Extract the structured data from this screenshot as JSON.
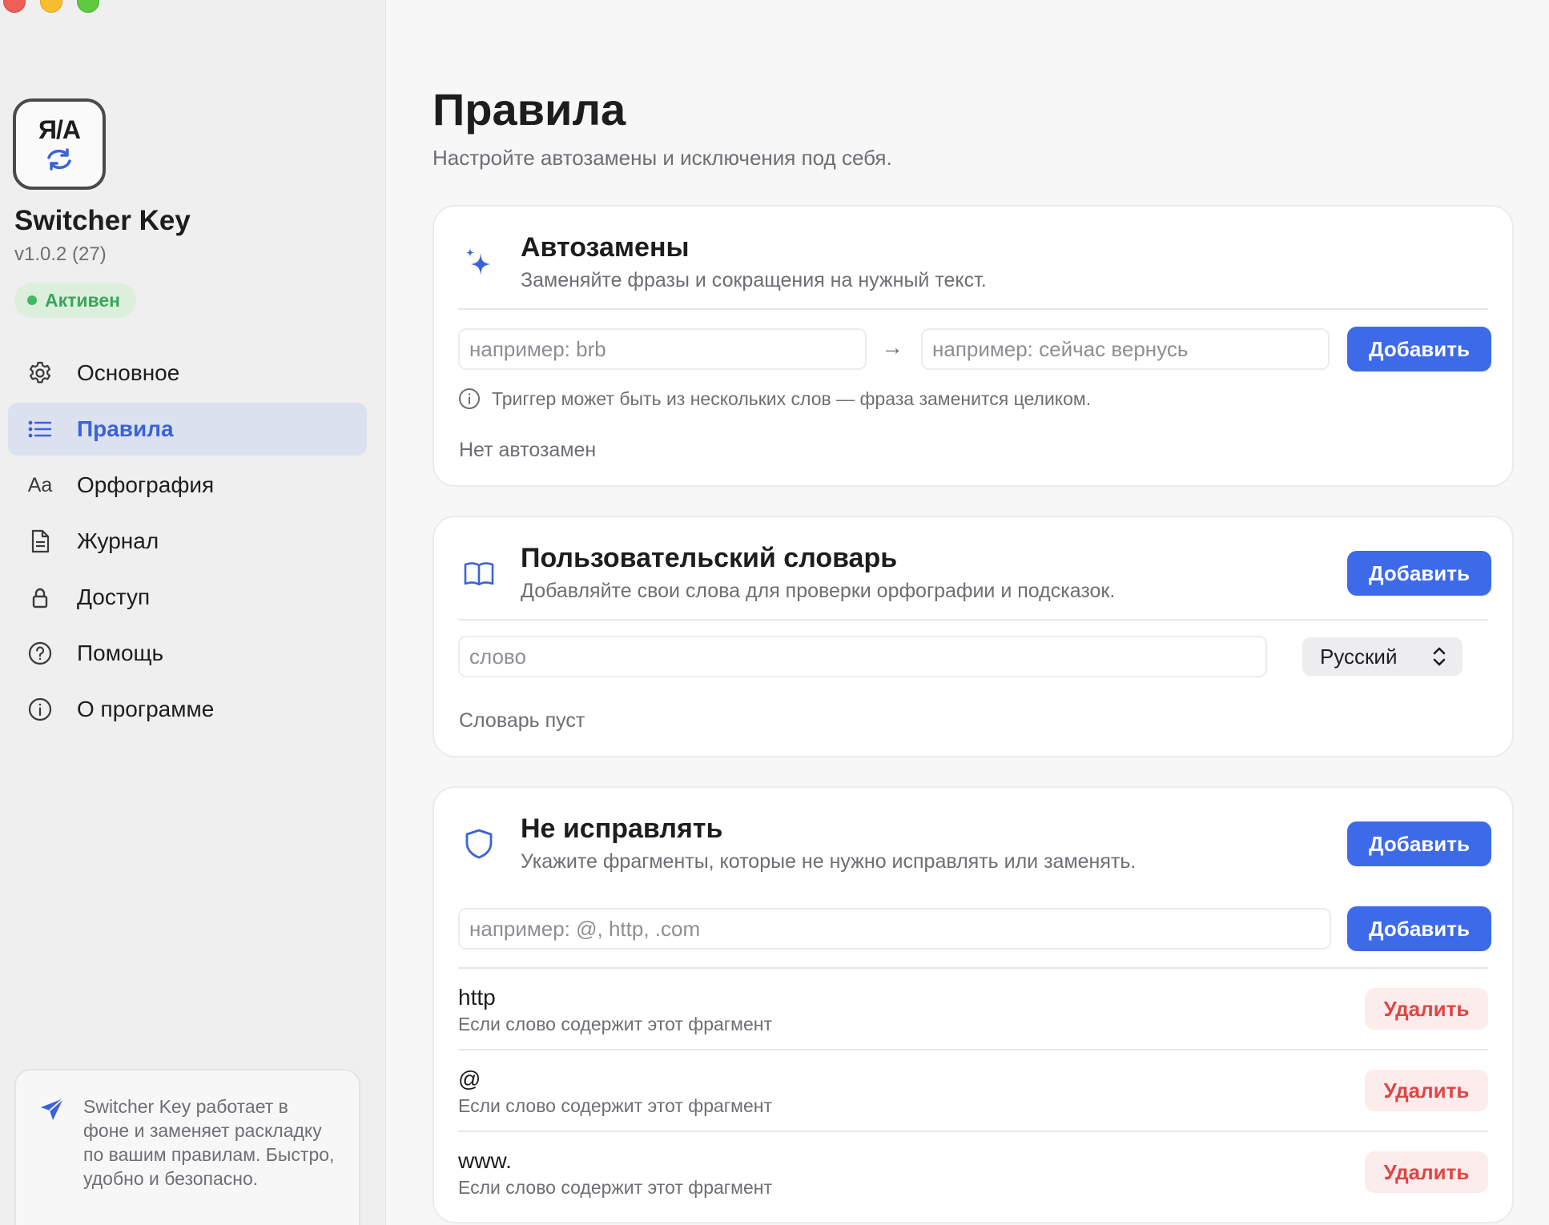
{
  "app": {
    "icon_text": "Я/А",
    "name": "Switcher Key",
    "version": "v1.0.2 (27)",
    "status": "Активен",
    "status_color": "#3fbb5f"
  },
  "sidebar": {
    "items": [
      {
        "label": "Основное",
        "icon": "gear-icon",
        "active": false
      },
      {
        "label": "Правила",
        "icon": "list-icon",
        "active": true
      },
      {
        "label": "Орфография",
        "icon": "text-aa-icon",
        "icon_text": "Aa",
        "active": false
      },
      {
        "label": "Журнал",
        "icon": "document-icon",
        "active": false
      },
      {
        "label": "Доступ",
        "icon": "lock-icon",
        "active": false
      },
      {
        "label": "Помощь",
        "icon": "question-circle-icon",
        "active": false
      },
      {
        "label": "О программе",
        "icon": "info-circle-icon",
        "active": false
      }
    ],
    "info_text": "Switcher Key работает в фоне и заменяет раскладку по вашим правилам. Быстро, удобно и безопасно."
  },
  "page": {
    "title": "Правила",
    "subtitle": "Настройте автозамены и исключения под себя."
  },
  "autoreplace": {
    "title": "Автозамены",
    "description": "Заменяйте фразы и сокращения на нужный текст.",
    "trigger_placeholder": "например: brb",
    "arrow": "→",
    "replacement_placeholder": "например: сейчас вернусь",
    "add_label": "Добавить",
    "hint": "Триггер может быть из нескольких слов — фраза заменится целиком.",
    "empty_text": "Нет автозамен"
  },
  "dictionary": {
    "title": "Пользовательский словарь",
    "description": "Добавляйте свои слова для проверки орфографии и подсказок.",
    "add_label": "Добавить",
    "word_placeholder": "слово",
    "language": "Русский",
    "empty_text": "Словарь пуст"
  },
  "exclusions": {
    "title": "Не исправлять",
    "description": "Укажите фрагменты, которые не нужно исправлять или заменять.",
    "add_label": "Добавить",
    "input_placeholder": "например: @, http, .com",
    "input_add_label": "Добавить",
    "delete_label": "Удалить",
    "items": [
      {
        "fragment": "http",
        "condition": "Если слово содержит этот фрагмент"
      },
      {
        "fragment": "@",
        "condition": "Если слово содержит этот фрагмент"
      },
      {
        "fragment": "www.",
        "condition": "Если слово содержит этот фрагмент"
      }
    ]
  },
  "colors": {
    "accent": "#3d6ae8",
    "danger": "#e04545",
    "sidebar_active_bg": "#dce1ef"
  }
}
